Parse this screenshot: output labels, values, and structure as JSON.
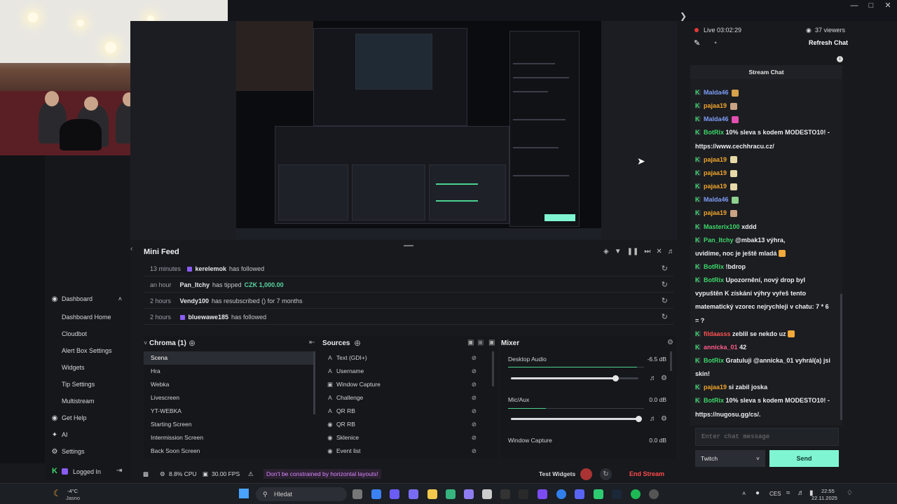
{
  "stream_header": {
    "live_time": "Live 03:02:29",
    "viewers": "37 viewers",
    "refresh_chat": "Refresh Chat",
    "stream_chat_title": "Stream Chat"
  },
  "sidebar": {
    "items": [
      {
        "label": "Dashboard",
        "icon": "palette-icon",
        "expanded": true
      },
      {
        "label": "Dashboard Home"
      },
      {
        "label": "Cloudbot"
      },
      {
        "label": "Alert Box Settings"
      },
      {
        "label": "Widgets"
      },
      {
        "label": "Tip Settings"
      },
      {
        "label": "Multistream"
      },
      {
        "label": "Get Help",
        "icon": "help-icon"
      },
      {
        "label": "AI",
        "icon": "ai-icon"
      },
      {
        "label": "Settings",
        "icon": "settings-icon"
      }
    ],
    "logged_in": "Logged In"
  },
  "mini_feed": {
    "title": "Mini Feed",
    "rows": [
      {
        "time": "13 minutes",
        "user": "kerelemok",
        "action": "has followed",
        "amount": ""
      },
      {
        "time": "an hour",
        "user": "Pan_Itchy",
        "action": "has tipped",
        "amount": "CZK 1,000.00"
      },
      {
        "time": "2 hours",
        "user": "Vendy100",
        "action": "has resubscribed () for 7 months",
        "amount": ""
      },
      {
        "time": "2 hours",
        "user": "bluewawe185",
        "action": "has followed",
        "amount": ""
      }
    ]
  },
  "scenes": {
    "title": "Chroma (1)",
    "items": [
      "Scena",
      "Hra",
      "Webka",
      "Livescreen",
      "YT-WEBKA",
      "Starting Screen",
      "Intermission Screen",
      "Back Soon Screen"
    ],
    "selected": "Scena"
  },
  "sources": {
    "title": "Sources",
    "items": [
      {
        "icon": "text-icon",
        "label": "Text (GDI+)"
      },
      {
        "icon": "text-icon",
        "label": "Username"
      },
      {
        "icon": "window-icon",
        "label": "Window Capture"
      },
      {
        "icon": "text-icon",
        "label": "Challenge"
      },
      {
        "icon": "text-icon",
        "label": "QR RB"
      },
      {
        "icon": "globe-icon",
        "label": "QR RB"
      },
      {
        "icon": "globe-icon",
        "label": "Sklenice"
      },
      {
        "icon": "globe-icon",
        "label": "Event list"
      }
    ]
  },
  "mixer": {
    "title": "Mixer",
    "channels": [
      {
        "name": "Desktop Audio",
        "db": "-6.5 dB",
        "level": 0.95,
        "volume": 0.82
      },
      {
        "name": "Mic/Aux",
        "db": "0.0 dB",
        "level": 0.28,
        "volume": 1.0
      },
      {
        "name": "Window Capture",
        "db": "0.0 dB",
        "level": 0,
        "volume": 1.0
      }
    ]
  },
  "status": {
    "cpu": "8.8% CPU",
    "fps": "30.00 FPS",
    "banner": "Don't be constrained by horizontal layouts!",
    "test_widgets": "Test Widgets",
    "end_stream": "End Stream"
  },
  "chat": {
    "messages": [
      {
        "user": "Malda46",
        "color": "#7f9cf5",
        "text": "",
        "emote": "#d7a14b"
      },
      {
        "user": "pajaa19",
        "color": "#f0a52c",
        "text": "",
        "emote": "#c9a383"
      },
      {
        "user": "Malda46",
        "color": "#7f9cf5",
        "text": "",
        "emote": "#e24fb0"
      },
      {
        "user": "BotRix",
        "color": "#3ed76a",
        "text": "10% sleva s kodem MODESTO10! -",
        "emote": ""
      },
      {
        "user": "",
        "color": "#eceef0",
        "text": "https://www.cechhracu.cz/",
        "emote": ""
      },
      {
        "user": "pajaa19",
        "color": "#f0a52c",
        "text": "",
        "emote": "#e7d9a8"
      },
      {
        "user": "pajaa19",
        "color": "#f0a52c",
        "text": "",
        "emote": "#e7d9a8"
      },
      {
        "user": "pajaa19",
        "color": "#f0a52c",
        "text": "",
        "emote": "#e7d9a8"
      },
      {
        "user": "Malda46",
        "color": "#7f9cf5",
        "text": "",
        "emote": "#8fd18f"
      },
      {
        "user": "pajaa19",
        "color": "#f0a52c",
        "text": "",
        "emote": "#c9a383"
      },
      {
        "user": "Masterix100",
        "color": "#3ed76a",
        "text": "xddd",
        "emote": ""
      },
      {
        "user": "Pan_Itchy",
        "color": "#3ed76a",
        "text": "@mbak13 výhra,",
        "emote": ""
      },
      {
        "user": "",
        "color": "#eceef0",
        "text": "uvidíme, noc je ještě mladá",
        "emote": "#f2a93b"
      },
      {
        "user": "BotRix",
        "color": "#3ed76a",
        "text": "!bdrop",
        "emote": ""
      },
      {
        "user": "BotRix",
        "color": "#3ed76a",
        "text": "Upozornění, nový drop byl",
        "emote": ""
      },
      {
        "user": "",
        "color": "#eceef0",
        "text": "vypuštěn  K získání výhry vyřeš tento",
        "emote": ""
      },
      {
        "user": "",
        "color": "#eceef0",
        "text": "matematický vzorec nejrychleji v chatu: 7 * 6",
        "emote": ""
      },
      {
        "user": "",
        "color": "#eceef0",
        "text": "= ?",
        "emote": ""
      },
      {
        "user": "fildaasss",
        "color": "#ff5252",
        "text": "zeblil se nekdo uz",
        "emote": "#f2a93b"
      },
      {
        "user": "annicka_01",
        "color": "#ff5c8a",
        "text": "42",
        "emote": ""
      },
      {
        "user": "BotRix",
        "color": "#3ed76a",
        "text": "Gratuluji @annicka_01 vyhrál(a) jsi",
        "emote": ""
      },
      {
        "user": "",
        "color": "#eceef0",
        "text": "skin!",
        "emote": ""
      },
      {
        "user": "pajaa19",
        "color": "#f0a52c",
        "text": "si zabil joska",
        "emote": ""
      },
      {
        "user": "BotRix",
        "color": "#3ed76a",
        "text": "10% sleva s kodem MODESTO10! -",
        "emote": ""
      },
      {
        "user": "",
        "color": "#eceef0",
        "text": "https://nugosu.gg/cs/.",
        "emote": ""
      }
    ],
    "input_placeholder": "Enter chat message",
    "platform": "Twitch",
    "send": "Send"
  },
  "taskbar": {
    "weather_temp": "-4°C",
    "weather_desc": "Jasno",
    "search": "Hledat",
    "lang": "CES",
    "time": "22:55",
    "date": "22.11.2025"
  }
}
